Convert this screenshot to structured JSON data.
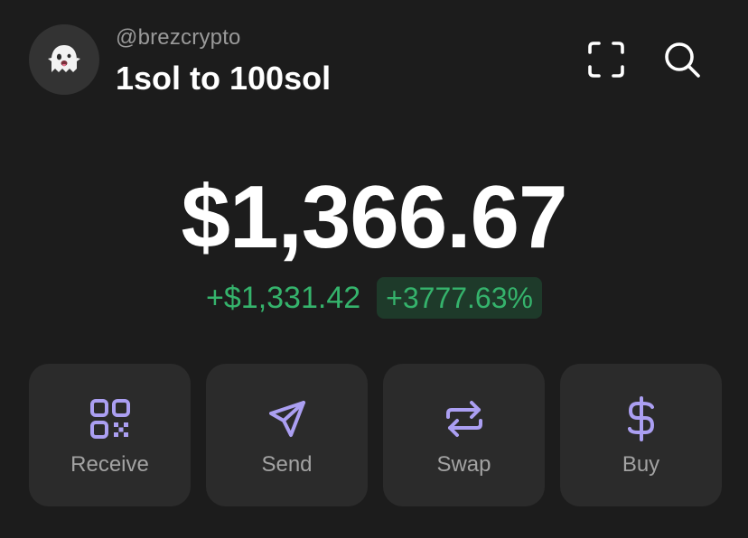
{
  "header": {
    "username": "@brezcrypto",
    "account_name": "1sol to 100sol",
    "avatar_icon": "ghost-icon",
    "scan_icon": "scan-icon",
    "search_icon": "search-icon"
  },
  "balance": {
    "total": "$1,366.67",
    "change_amount": "+$1,331.42",
    "change_percent": "+3777.63%"
  },
  "actions": [
    {
      "label": "Receive",
      "icon": "qr-code-icon"
    },
    {
      "label": "Send",
      "icon": "send-icon"
    },
    {
      "label": "Swap",
      "icon": "swap-icon"
    },
    {
      "label": "Buy",
      "icon": "dollar-icon"
    }
  ],
  "colors": {
    "background": "#1c1c1c",
    "card": "#2b2b2b",
    "accent_purple": "#ab9ff2",
    "positive_green": "#35b36c",
    "positive_green_bg": "#1e3a2a",
    "muted_text": "#9a9a9a"
  }
}
